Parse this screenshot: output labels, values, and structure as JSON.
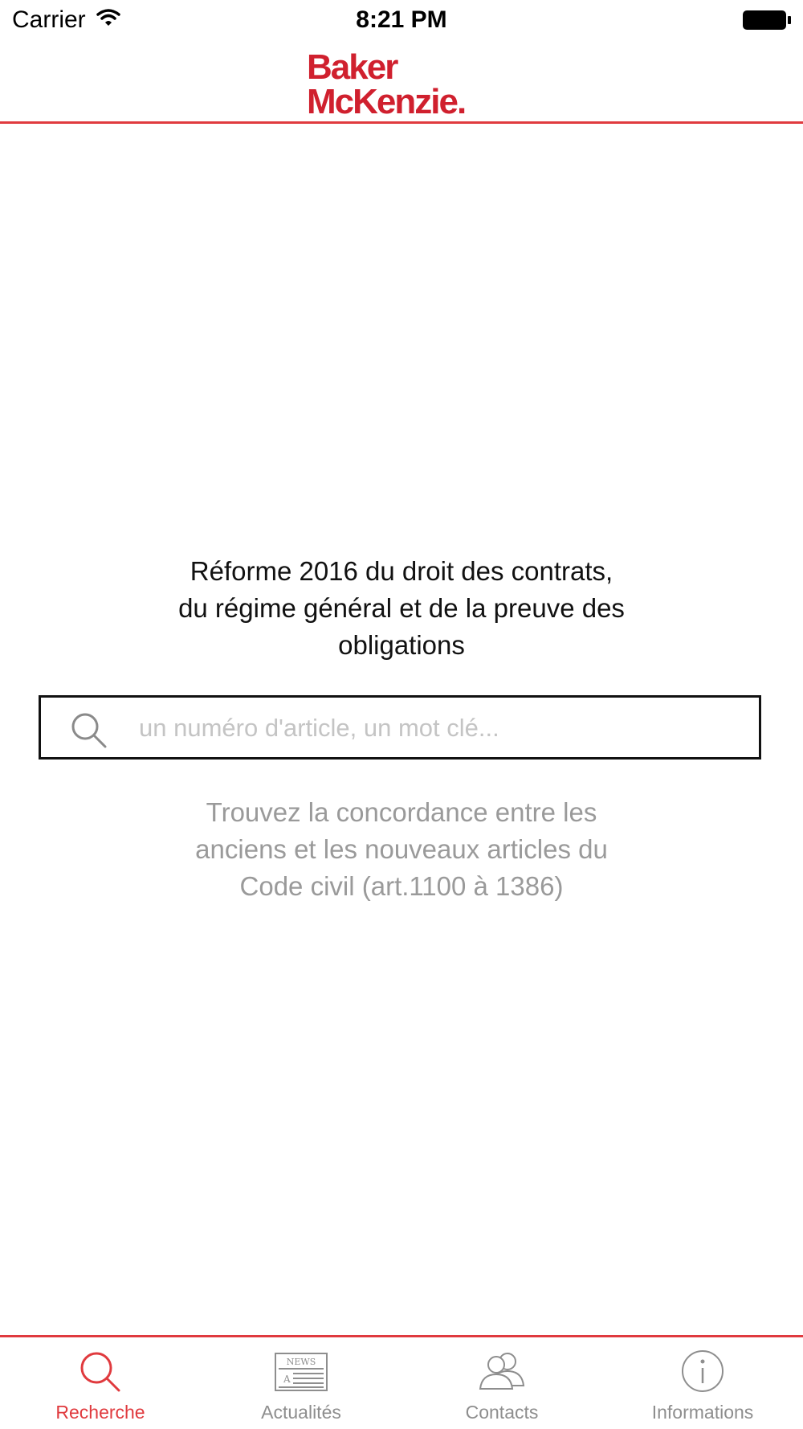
{
  "status_bar": {
    "carrier": "Carrier",
    "time": "8:21 PM"
  },
  "nav": {
    "logo_line1": "Baker",
    "logo_line2": "McKenzie",
    "logo_color": "#d0202e"
  },
  "main": {
    "headline": [
      "Réforme 2016 du droit des contrats,",
      "du régime général et de la preuve des",
      "obligations"
    ],
    "search_placeholder": "un numéro d'article, un mot clé...",
    "hint": [
      "Trouvez la concordance entre les",
      "anciens et les nouveaux articles du",
      "Code civil (art.1100 à 1386)"
    ]
  },
  "tabs": [
    {
      "label": "Recherche",
      "icon": "search-icon",
      "active": true
    },
    {
      "label": "Actualités",
      "icon": "news-icon",
      "active": false
    },
    {
      "label": "Contacts",
      "icon": "contacts-icon",
      "active": false
    },
    {
      "label": "Informations",
      "icon": "info-icon",
      "active": false
    }
  ],
  "colors": {
    "accent": "#e03a3e",
    "inactive": "#8e8e8e"
  }
}
